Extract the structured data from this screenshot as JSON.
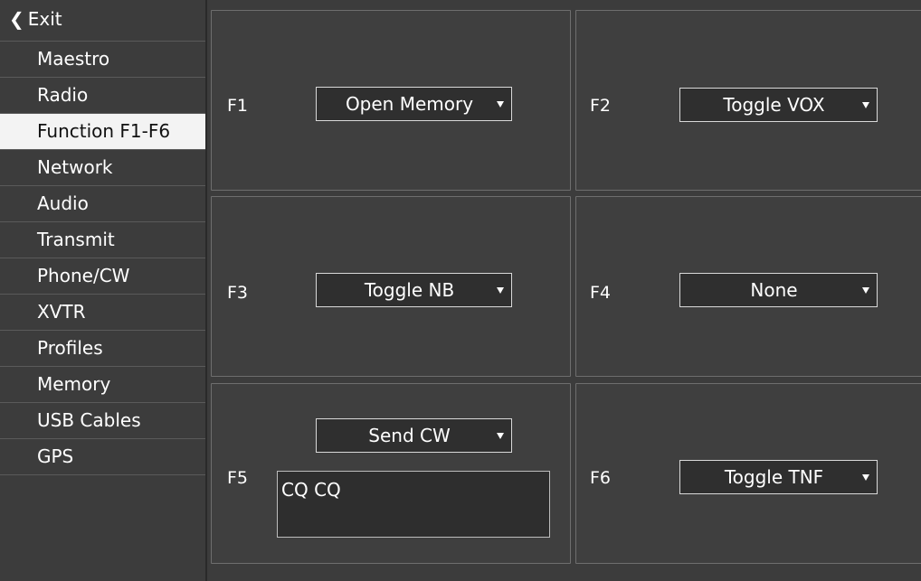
{
  "sidebar": {
    "exit_label": "Exit",
    "items": [
      {
        "label": "Maestro"
      },
      {
        "label": "Radio"
      },
      {
        "label": "Function F1-F6",
        "active": true
      },
      {
        "label": "Network"
      },
      {
        "label": "Audio"
      },
      {
        "label": "Transmit"
      },
      {
        "label": "Phone/CW"
      },
      {
        "label": "XVTR"
      },
      {
        "label": "Profiles"
      },
      {
        "label": "Memory"
      },
      {
        "label": "USB Cables"
      },
      {
        "label": "GPS"
      }
    ]
  },
  "functions": {
    "f1": {
      "label": "F1",
      "value": "Open Memory"
    },
    "f2": {
      "label": "F2",
      "value": "Toggle VOX"
    },
    "f3": {
      "label": "F3",
      "value": "Toggle NB"
    },
    "f4": {
      "label": "F4",
      "value": "None"
    },
    "f5": {
      "label": "F5",
      "value": "Send CW",
      "text": "CQ CQ"
    },
    "f6": {
      "label": "F6",
      "value": "Toggle TNF"
    }
  },
  "colors": {
    "background": "#3c3c3c",
    "active_item_bg": "#f3f3f3",
    "dropdown_bg": "#2f2f2f",
    "textbox_bg": "#2e2e2e"
  },
  "icons": {
    "exit": "chevron-left-icon",
    "dropdown": "triangle-down-icon"
  }
}
